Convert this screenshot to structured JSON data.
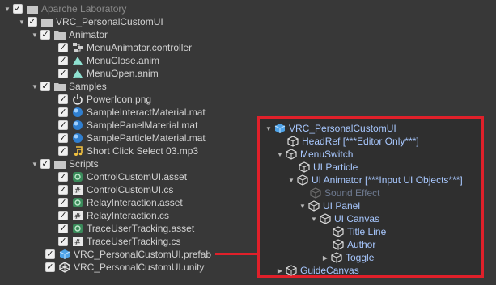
{
  "project_tree": {
    "root": {
      "label": "Aparche Laboratory"
    },
    "folder": {
      "label": "VRC_PersonalCustomUI"
    },
    "animator": {
      "label": "Animator",
      "items": [
        {
          "label": "MenuAnimator.controller",
          "icon": "animator-controller-icon"
        },
        {
          "label": "MenuClose.anim",
          "icon": "animation-clip-icon"
        },
        {
          "label": "MenuOpen.anim",
          "icon": "animation-clip-icon"
        }
      ]
    },
    "samples": {
      "label": "Samples",
      "items": [
        {
          "label": "PowerIcon.png",
          "icon": "power-icon"
        },
        {
          "label": "SampleInteractMaterial.mat",
          "icon": "material-sphere-icon"
        },
        {
          "label": "SamplePanelMaterial.mat",
          "icon": "material-sphere-icon"
        },
        {
          "label": "SampleParticleMaterial.mat",
          "icon": "material-sphere-icon"
        },
        {
          "label": "Short Click Select 03.mp3",
          "icon": "audio-note-icon"
        }
      ]
    },
    "scripts": {
      "label": "Scripts",
      "items": [
        {
          "label": "ControlCustomUI.asset",
          "icon": "udon-asset-icon"
        },
        {
          "label": "ControlCustomUI.cs",
          "icon": "csharp-script-icon"
        },
        {
          "label": "RelayInteraction.asset",
          "icon": "udon-asset-icon"
        },
        {
          "label": "RelayInteraction.cs",
          "icon": "csharp-script-icon"
        },
        {
          "label": "TraceUserTracking.asset",
          "icon": "udon-asset-icon"
        },
        {
          "label": "TraceUserTracking.cs",
          "icon": "csharp-script-icon"
        }
      ]
    },
    "prefab": {
      "label": "VRC_PersonalCustomUI.prefab"
    },
    "unity": {
      "label": "VRC_PersonalCustomUI.unity"
    }
  },
  "hierarchy_panel": {
    "root": "VRC_PersonalCustomUI",
    "items": [
      {
        "label": "HeadRef [***Editor Only***]"
      },
      {
        "label": "MenuSwitch"
      },
      {
        "label": "UI Particle"
      },
      {
        "label": "UI Animator [***Input UI Objects***]"
      },
      {
        "label": "Sound Effect"
      },
      {
        "label": "UI Panel"
      },
      {
        "label": "UI Canvas"
      },
      {
        "label": "Title Line"
      },
      {
        "label": "Author"
      },
      {
        "label": "Toggle"
      },
      {
        "label": "GuideCanvas"
      }
    ]
  },
  "colors": {
    "background": "#383838",
    "highlight_border": "#e0202a",
    "hierarchy_text": "#a8c8ff"
  }
}
